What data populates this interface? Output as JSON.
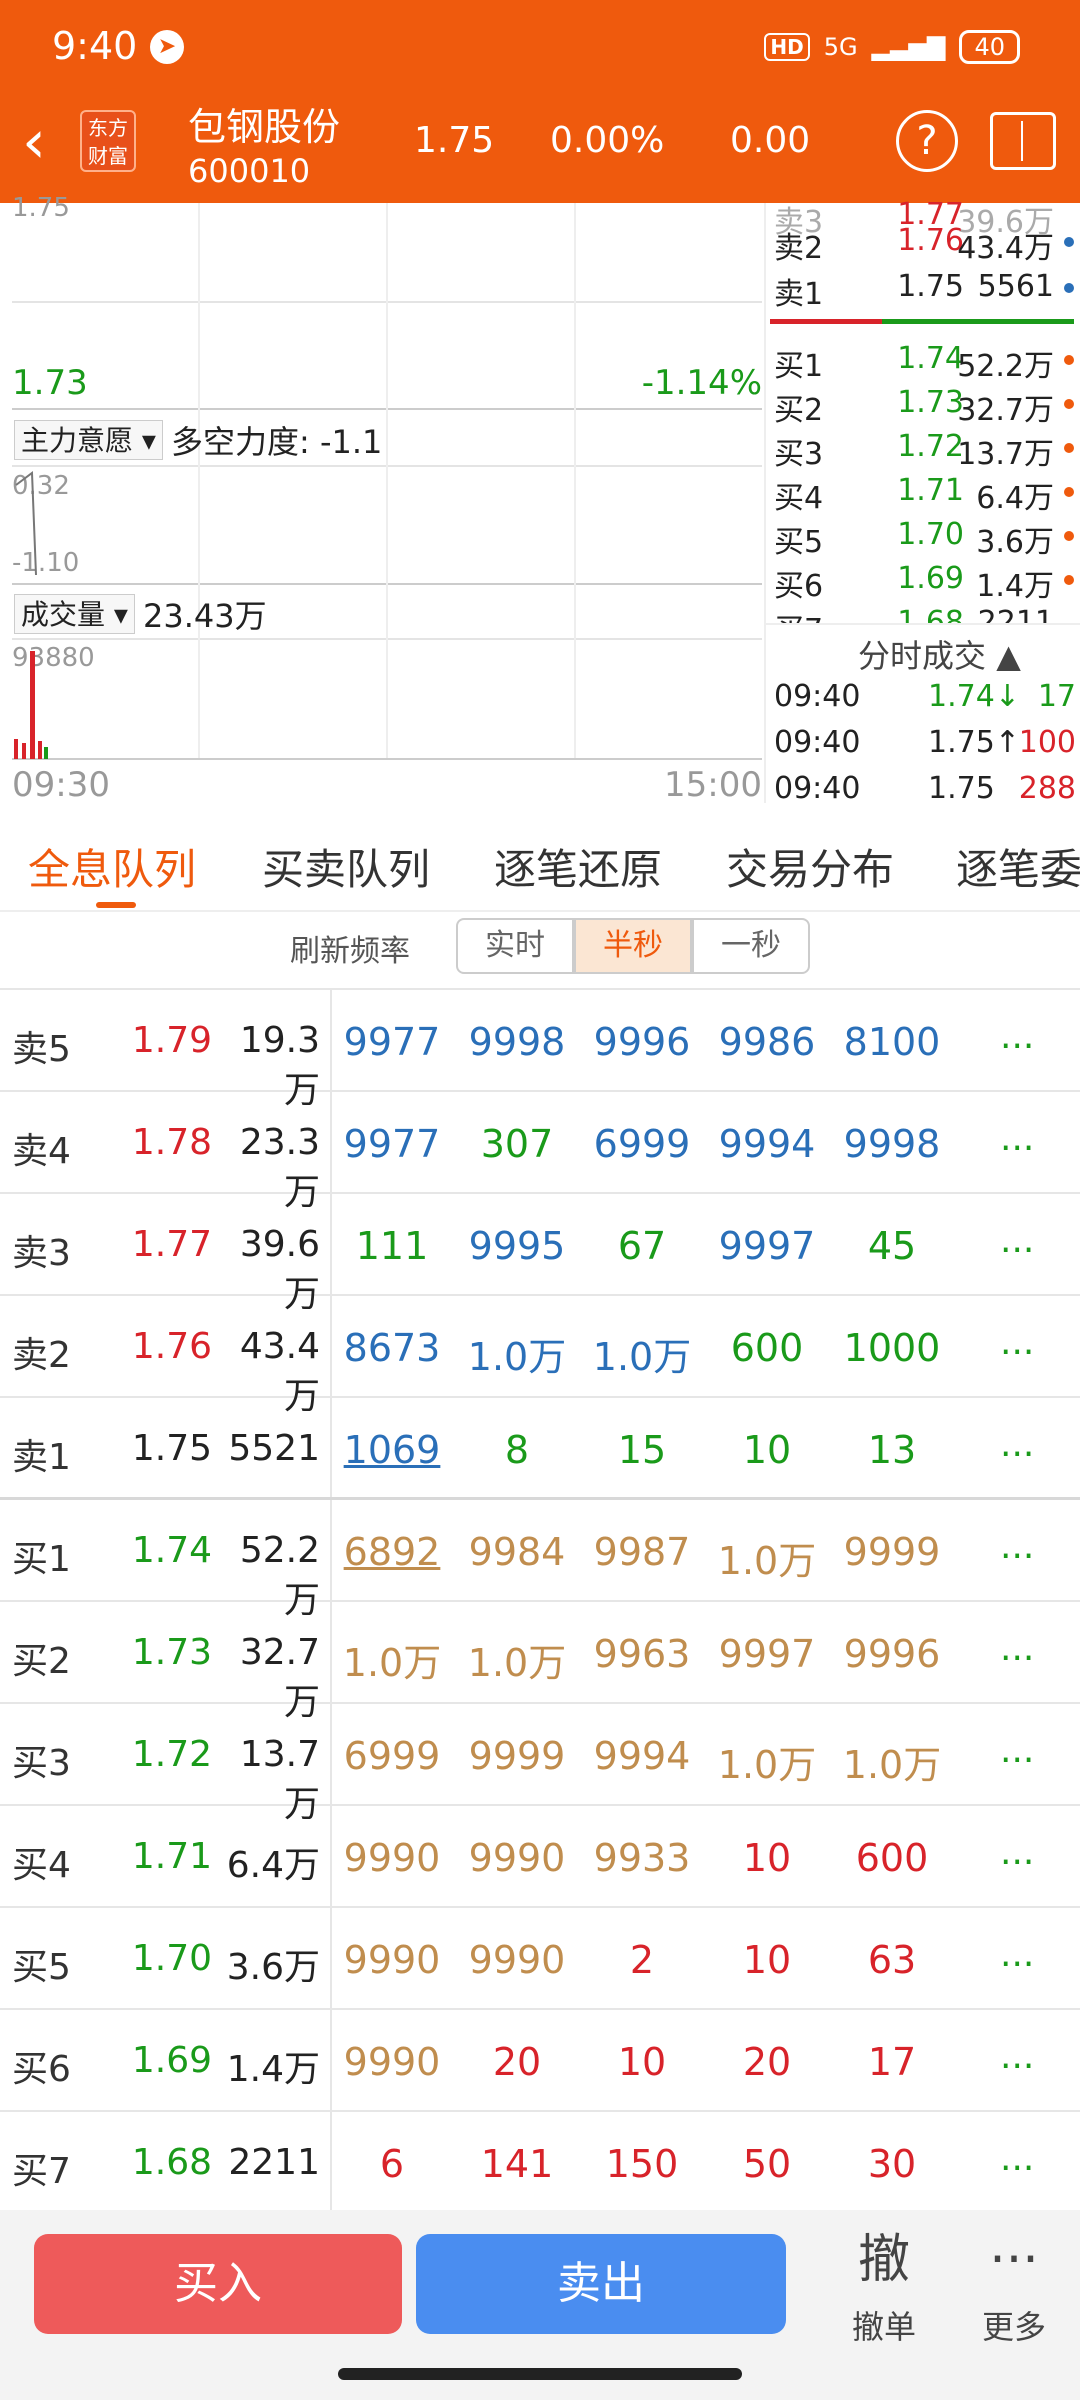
{
  "status_bar": {
    "time": "9:40",
    "network": "5G",
    "battery": "40",
    "hd": "HD"
  },
  "header": {
    "logo_line1": "东方",
    "logo_line2": "财富",
    "stock_name": "包钢股份",
    "stock_code": "600010",
    "price": "1.75",
    "change_pct": "0.00%",
    "change": "0.00"
  },
  "chart": {
    "price_low": "1.73",
    "pct_low": "-1.14%",
    "top_partial": "1.75",
    "indicator_label": "主力意愿",
    "indicator_text": "多空力度: -1.1",
    "ind_max": "0.32",
    "ind_min": "-1.10",
    "volume_label": "成交量",
    "volume_text": "23.43万",
    "vol_max": "93880",
    "time_start": "09:30",
    "time_end": "15:00"
  },
  "order_book": {
    "rows": [
      {
        "label": "卖3",
        "price": "1.77",
        "vol": "39.6万"
      },
      {
        "label": "卖2",
        "price": "1.76",
        "vol": "43.4万"
      },
      {
        "label": "卖1",
        "price": "1.75",
        "vol": "5561"
      },
      {
        "label": "买1",
        "price": "1.74",
        "vol": "52.2万"
      },
      {
        "label": "买2",
        "price": "1.73",
        "vol": "32.7万"
      },
      {
        "label": "买3",
        "price": "1.72",
        "vol": "13.7万"
      },
      {
        "label": "买4",
        "price": "1.71",
        "vol": "6.4万"
      },
      {
        "label": "买5",
        "price": "1.70",
        "vol": "3.6万"
      },
      {
        "label": "买6",
        "price": "1.69",
        "vol": "1.4万"
      },
      {
        "label": "买7",
        "price": "1.68",
        "vol": "2211"
      }
    ],
    "trades_title": "分时成交",
    "trades": [
      {
        "time": "09:40",
        "price": "1.74↓",
        "vol": "17"
      },
      {
        "time": "09:40",
        "price": "1.75↑",
        "vol": "100"
      },
      {
        "time": "09:40",
        "price": "1.75",
        "vol": "288"
      }
    ]
  },
  "tabs": [
    "全息队列",
    "买卖队列",
    "逐笔还原",
    "交易分布",
    "逐笔委"
  ],
  "refresh": {
    "label": "刷新频率",
    "options": [
      "实时",
      "半秒",
      "一秒"
    ],
    "selected": "半秒"
  },
  "queue": [
    {
      "label": "卖5",
      "price": "1.79",
      "vol": "19.3万",
      "cells": [
        "9977",
        "9998",
        "9996",
        "9986",
        "8100"
      ]
    },
    {
      "label": "卖4",
      "price": "1.78",
      "vol": "23.3万",
      "cells": [
        "9977",
        "307",
        "6999",
        "9994",
        "9998"
      ]
    },
    {
      "label": "卖3",
      "price": "1.77",
      "vol": "39.6万",
      "cells": [
        "111",
        "9995",
        "67",
        "9997",
        "45"
      ]
    },
    {
      "label": "卖2",
      "price": "1.76",
      "vol": "43.4万",
      "cells": [
        "8673",
        "1.0万",
        "1.0万",
        "600",
        "1000"
      ]
    },
    {
      "label": "卖1",
      "price": "1.75",
      "vol": "5521",
      "cells": [
        "1069",
        "8",
        "15",
        "10",
        "13"
      ]
    },
    {
      "label": "买1",
      "price": "1.74",
      "vol": "52.2万",
      "cells": [
        "6892",
        "9984",
        "9987",
        "1.0万",
        "9999"
      ]
    },
    {
      "label": "买2",
      "price": "1.73",
      "vol": "32.7万",
      "cells": [
        "1.0万",
        "1.0万",
        "9963",
        "9997",
        "9996"
      ]
    },
    {
      "label": "买3",
      "price": "1.72",
      "vol": "13.7万",
      "cells": [
        "6999",
        "9999",
        "9994",
        "1.0万",
        "1.0万"
      ]
    },
    {
      "label": "买4",
      "price": "1.71",
      "vol": "6.4万",
      "cells": [
        "9990",
        "9990",
        "9933",
        "10",
        "600"
      ]
    },
    {
      "label": "买5",
      "price": "1.70",
      "vol": "3.6万",
      "cells": [
        "9990",
        "9990",
        "2",
        "10",
        "63"
      ]
    },
    {
      "label": "买6",
      "price": "1.69",
      "vol": "1.4万",
      "cells": [
        "9990",
        "20",
        "10",
        "20",
        "17"
      ]
    },
    {
      "label": "买7",
      "price": "1.68",
      "vol": "2211",
      "cells": [
        "6",
        "141",
        "150",
        "50",
        "30"
      ]
    }
  ],
  "more_dots": "...",
  "bottom": {
    "buy": "买入",
    "sell": "卖出",
    "cancel_icon": "撤",
    "cancel": "撤单",
    "more_icon": "···",
    "more": "更多"
  },
  "colors": {
    "accent": "#ef5a0d",
    "up": "#d8232a",
    "down": "#1a9a1a",
    "buy_btn": "#ee5a5a",
    "sell_btn": "#4a8df0"
  }
}
